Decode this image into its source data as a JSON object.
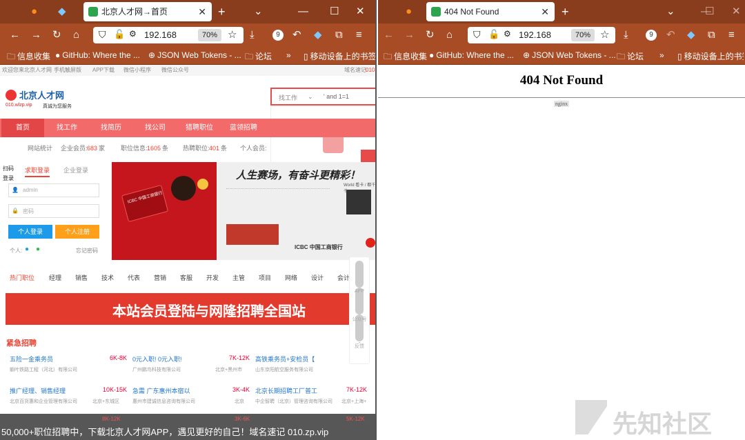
{
  "left": {
    "tab_title": "北京人才网→首页",
    "url": "192.168",
    "zoom": "70%",
    "badge": "9",
    "bookmarks": [
      "信息收集",
      "GitHub: Where the ...",
      "JSON Web Tokens - ...",
      "论坛"
    ],
    "bookmarks_more": "移动设备上的书签"
  },
  "right": {
    "tab_title": "404 Not Found",
    "url": "192.168",
    "zoom": "70%",
    "badge": "9",
    "bookmarks": [
      "信息收集",
      "GitHub: Where the ...",
      "JSON Web Tokens - ...",
      "论坛"
    ],
    "bookmarks_more": "移动设备上的书签",
    "heading": "404 Not Found",
    "footer": "nginx"
  },
  "site": {
    "topbar_left": "欢迎您来北京人才网",
    "topbar_items": [
      "手机触屏版",
      "APP下载",
      "微信小程序",
      "微信公众号"
    ],
    "topbar_right": "域名速记",
    "topbar_domain": "010",
    "logo_text": "北京人才网",
    "logo_domain": "010.wlzp.vip",
    "logo_slogan": "真诚为您服务",
    "search_type": "找工作",
    "search_value": "' and 1=1",
    "login_label": "登录",
    "menu": [
      "首页",
      "找工作",
      "找简历",
      "找公司",
      "猎聘职位",
      "蓝领招聘"
    ],
    "stats": {
      "label": "网站统计",
      "company_label": "企业会员:",
      "company": "683",
      "company_unit": "家",
      "jobs_label": "职位信息:",
      "jobs": "1605",
      "jobs_unit": "条",
      "hot_label": "热聘职位:",
      "hot": "401",
      "hot_unit": "条",
      "person_label": "个人会员:"
    },
    "login": {
      "scan": "扫码登录",
      "tab1": "求职登录",
      "tab2": "企业登录",
      "user_placeholder": "admin",
      "pass_placeholder": "密码",
      "btn_login": "个人登录",
      "btn_register": "个人注册",
      "person": "个人:",
      "forgot": "忘记密码"
    },
    "banner": {
      "slogan": "人生赛场，有奋斗更精彩！",
      "bank": "ICBC 中国工商银行",
      "card": "ICBC 中国工商银行",
      "brand": "World 看卡 / 都千千"
    },
    "categories": [
      "热门职位",
      "经理",
      "销售",
      "技术",
      "代表",
      "营销",
      "客服",
      "开发",
      "主管",
      "项目",
      "网络",
      "设计",
      "会计"
    ],
    "ad_text": "本站会员登陆与网隆招聘全国站",
    "urgent_title": "紧急招聘",
    "jobs": [
      {
        "title": "五险一金乘务员",
        "salary": "6K-8K",
        "company": "躺叶铁路工程（河北）有限公司",
        "loc": ""
      },
      {
        "title": "0元入职! 0元入职!",
        "salary": "7K-12K",
        "company": "广州鹏鸟科技有限公司",
        "loc": "北京+黑州市"
      },
      {
        "title": "高铁乘务员+安检员【",
        "salary": "",
        "company": "山东京阳航空服务有限公司",
        "loc": ""
      },
      {
        "title": "推广经理、销售经理",
        "salary": "10K-15K",
        "company": "北京百货惠和企业管理有限公司",
        "loc": "北京+东城区"
      },
      {
        "title": "急需 广东惠州本宿以",
        "salary": "3K-4K",
        "company": "惠州市建诚信息咨询有限公司",
        "loc": "北京"
      },
      {
        "title": "北京长期招聘工厂普工",
        "salary": "7K-12K",
        "company": "中企智聘（北京）管理咨询有限公司",
        "loc": "北京+上海+"
      }
    ],
    "side": [
      "APP",
      "公众号",
      "反馈",
      ""
    ],
    "side_icons": [
      "app-icon",
      "wechat-icon",
      "feedback-icon",
      "back-to-top-icon"
    ],
    "bottom_overlay": "50,000+职位招聘中，下载北京人才网APP，遇见更好的自己！域名速记 010.zp.vip",
    "peek_salaries": [
      "8K-12K",
      "3K-6K",
      "5K-12K"
    ]
  },
  "watermark": "先知社区",
  "colors": {
    "browser": "#a84c26",
    "menu": "#f36a6a",
    "accent": "#e24646"
  }
}
